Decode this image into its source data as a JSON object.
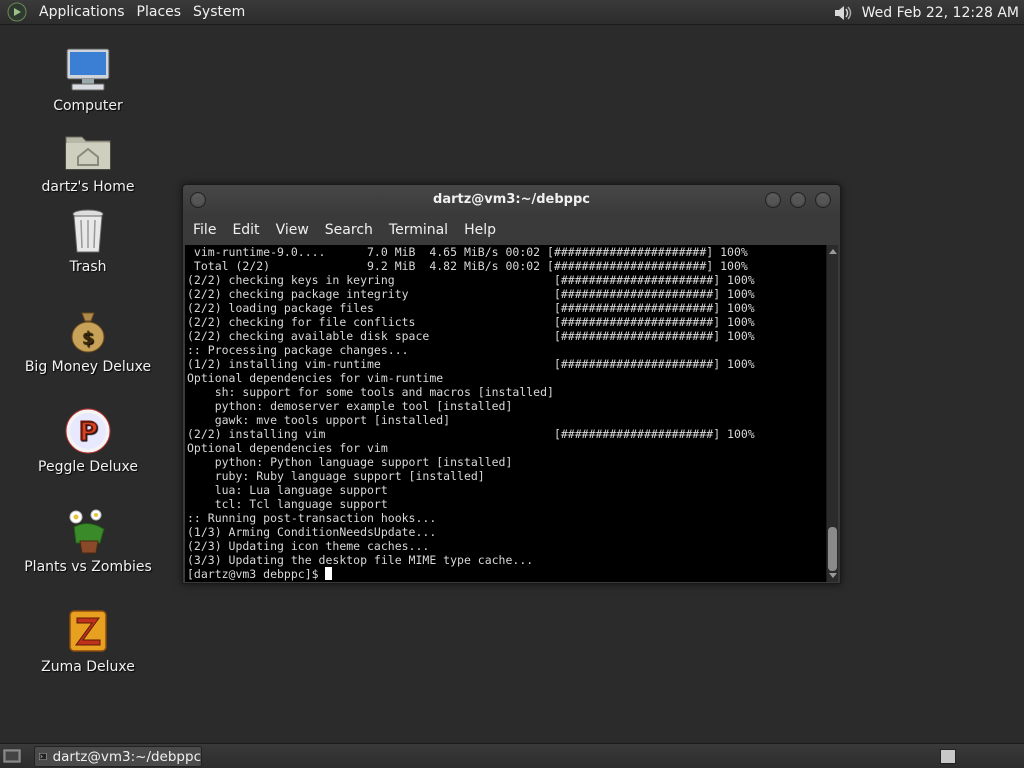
{
  "top_panel": {
    "menus": [
      "Applications",
      "Places",
      "System"
    ],
    "clock": "Wed Feb 22, 12:28 AM"
  },
  "desktop_icons": [
    {
      "label": "Computer",
      "icon": "computer-icon"
    },
    {
      "label": "dartz's Home",
      "icon": "home-folder-icon"
    },
    {
      "label": "Trash",
      "icon": "trash-icon"
    },
    {
      "label": "Big Money Deluxe",
      "icon": "money-bag-icon"
    },
    {
      "label": "Peggle Deluxe",
      "icon": "peggle-icon"
    },
    {
      "label": "Plants vs Zombies",
      "icon": "plants-vs-zombies-icon"
    },
    {
      "label": "Zuma Deluxe",
      "icon": "zuma-icon"
    }
  ],
  "terminal": {
    "title": "dartz@vm3:~/debppc",
    "menu": [
      "File",
      "Edit",
      "View",
      "Search",
      "Terminal",
      "Help"
    ],
    "lines": [
      " vim-runtime-9.0....      7.0 MiB  4.65 MiB/s 00:02 [######################] 100%",
      " Total (2/2)              9.2 MiB  4.82 MiB/s 00:02 [######################] 100%",
      "(2/2) checking keys in keyring                       [######################] 100%",
      "(2/2) checking package integrity                     [######################] 100%",
      "(2/2) loading package files                          [######################] 100%",
      "(2/2) checking for file conflicts                    [######################] 100%",
      "(2/2) checking available disk space                  [######################] 100%",
      ":: Processing package changes...",
      "(1/2) installing vim-runtime                         [######################] 100%",
      "Optional dependencies for vim-runtime",
      "    sh: support for some tools and macros [installed]",
      "    python: demoserver example tool [installed]",
      "    gawk: mve tools upport [installed]",
      "(2/2) installing vim                                 [######################] 100%",
      "Optional dependencies for vim",
      "    python: Python language support [installed]",
      "    ruby: Ruby language support [installed]",
      "    lua: Lua language support",
      "    tcl: Tcl language support",
      ":: Running post-transaction hooks...",
      "(1/3) Arming ConditionNeedsUpdate...",
      "(2/3) Updating icon theme caches...",
      "(3/3) Updating the desktop file MIME type cache..."
    ],
    "prompt": "[dartz@vm3 debppc]$ "
  },
  "bottom_panel": {
    "task_label": "dartz@vm3:~/debppc"
  }
}
